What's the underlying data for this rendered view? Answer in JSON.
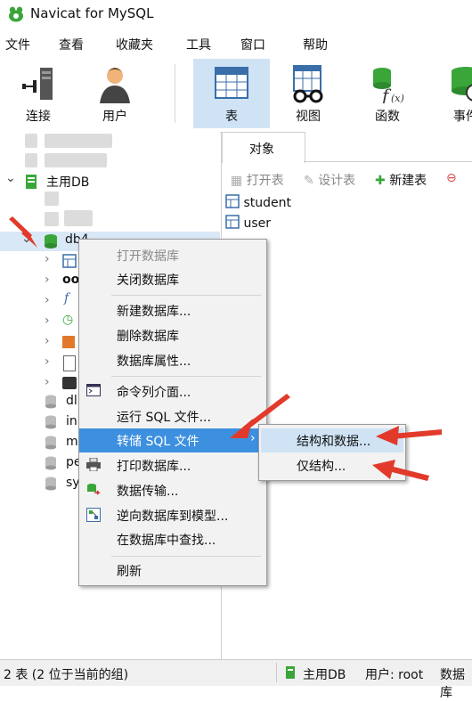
{
  "window": {
    "title": "Navicat for MySQL"
  },
  "menubar": [
    "文件",
    "查看",
    "收藏夹",
    "工具",
    "窗口",
    "帮助"
  ],
  "toolbar": {
    "buttons": [
      {
        "label": "连接",
        "icon": "plug-icon"
      },
      {
        "label": "用户",
        "icon": "user-icon"
      },
      {
        "label": "表",
        "icon": "table-icon",
        "active": true
      },
      {
        "label": "视图",
        "icon": "view-icon"
      },
      {
        "label": "函数",
        "icon": "function-icon"
      },
      {
        "label": "事件",
        "icon": "event-icon"
      }
    ]
  },
  "tree": {
    "connection": "主用DB",
    "selected_db": "db4",
    "partial_rows": [
      "dl",
      "in",
      "m",
      "pe",
      "sy"
    ]
  },
  "object_pane": {
    "tab": "对象",
    "toolbar": [
      "打开表",
      "设计表",
      "新建表"
    ],
    "tables": [
      "student",
      "user"
    ]
  },
  "context_menu": {
    "items": [
      {
        "label": "打开数据库",
        "disabled": true
      },
      {
        "label": "关闭数据库"
      },
      {
        "label": "新建数据库..."
      },
      {
        "label": "删除数据库"
      },
      {
        "label": "数据库属性..."
      },
      {
        "label": "命令列介面..."
      },
      {
        "label": "运行 SQL 文件..."
      },
      {
        "label": "转储 SQL 文件",
        "highlighted": true,
        "submenu": true
      },
      {
        "label": "打印数据库..."
      },
      {
        "label": "数据传输..."
      },
      {
        "label": "逆向数据库到模型..."
      },
      {
        "label": "在数据库中查找..."
      },
      {
        "label": "刷新"
      }
    ],
    "submenu": [
      {
        "label": "结构和数据...",
        "highlighted": true
      },
      {
        "label": "仅结构..."
      }
    ]
  },
  "statusbar": {
    "left": "2 表 (2 位于当前的组)",
    "connection": "主用DB",
    "user": "用户: root",
    "db": "数据库"
  },
  "colors": {
    "accent": "#3d90df",
    "annotation_arrow": "#e23a2a",
    "db_green": "#3aa63a"
  }
}
